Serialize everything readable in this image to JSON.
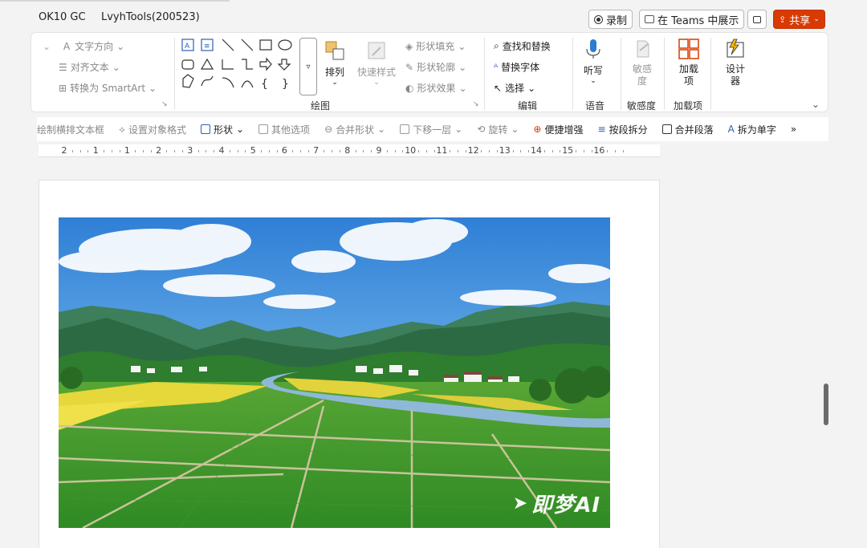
{
  "titlebar": {
    "tabs": [
      "OK10 GC",
      "LvyhTools(200523)"
    ],
    "record_label": "录制",
    "teams_label": "在 Teams 中展示",
    "share_label": "共享"
  },
  "ribbon": {
    "text_direction": "文字方向",
    "align_text": "对齐文本",
    "convert_smartart": "转换为 SmartArt",
    "arrange": "排列",
    "quick_styles": "快速样式",
    "shape_fill": "形状填充",
    "shape_outline": "形状轮廓",
    "shape_effect": "形状效果",
    "find_replace": "查找和替换",
    "replace_font": "替换字体",
    "select": "选择",
    "dictate": "听写",
    "sensitivity": "敏感度",
    "addins": "加载项",
    "designer": "设计器",
    "groups": {
      "drawing": "绘图",
      "editing": "编辑",
      "voice": "语音",
      "sensitivity": "敏感度",
      "addins": "加载项"
    }
  },
  "toolbar2": {
    "items": [
      {
        "label": "绘制横排文本框",
        "dark": false
      },
      {
        "label": "设置对象格式",
        "dark": false
      },
      {
        "label": "形状",
        "dark": true
      },
      {
        "label": "其他选项",
        "dark": false
      },
      {
        "label": "合并形状",
        "dark": false
      },
      {
        "label": "下移一层",
        "dark": false
      },
      {
        "label": "旋转",
        "dark": false
      },
      {
        "label": "便捷增强",
        "dark": true
      },
      {
        "label": "按段拆分",
        "dark": true
      },
      {
        "label": "合并段落",
        "dark": true
      },
      {
        "label": "拆为单字",
        "dark": true
      }
    ],
    "more": "»"
  },
  "ruler": {
    "labels": [
      "2",
      "1",
      "1",
      "2",
      "3",
      "4",
      "5",
      "6",
      "7",
      "8",
      "9",
      "10",
      "11",
      "12",
      "13",
      "14",
      "15",
      "16"
    ]
  },
  "image": {
    "watermark": "即梦AI"
  }
}
